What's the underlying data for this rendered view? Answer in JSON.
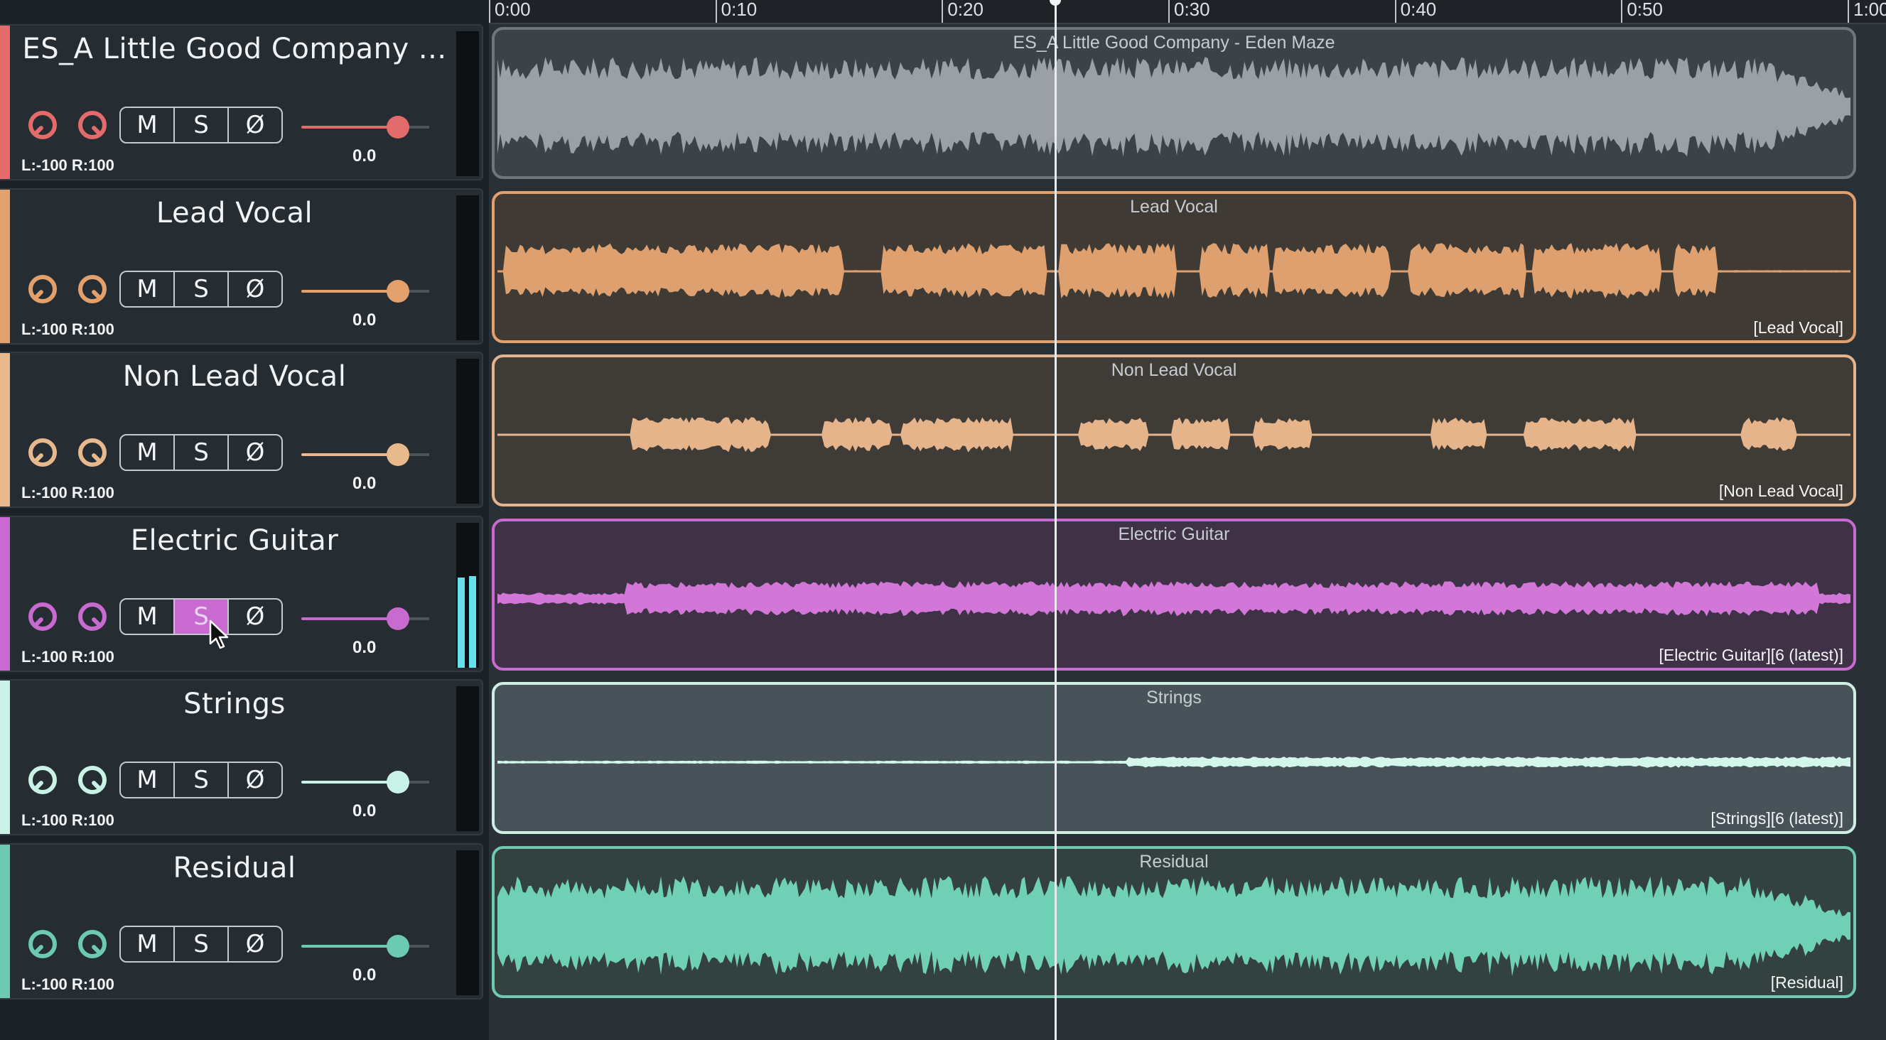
{
  "ruler": {
    "ticks": [
      {
        "label": "0:00",
        "seconds": 0
      },
      {
        "label": "0:10",
        "seconds": 10
      },
      {
        "label": "0:20",
        "seconds": 20
      },
      {
        "label": "0:30",
        "seconds": 30
      },
      {
        "label": "0:40",
        "seconds": 40
      },
      {
        "label": "0:50",
        "seconds": 50
      },
      {
        "label": "1:00",
        "seconds": 60
      }
    ],
    "playhead_seconds": 25
  },
  "tracks": [
    {
      "name": "ES_A Little Good Company ...",
      "color": "#e36b6b",
      "mute_label": "M",
      "solo_label": "S",
      "phase_label": "Ø",
      "solo_active": false,
      "pan_label": "L:-100 R:100",
      "volume": "0.0",
      "meter_level": 0,
      "clip": {
        "title": "ES_A Little Good Company - Eden Maze",
        "tag": "",
        "border": "#6e767e",
        "bg": "#3b4248",
        "wave": "#9aa0a5",
        "shape": "full"
      }
    },
    {
      "name": "Lead Vocal",
      "color": "#e4a06b",
      "mute_label": "M",
      "solo_label": "S",
      "phase_label": "Ø",
      "solo_active": false,
      "pan_label": "L:-100 R:100",
      "volume": "0.0",
      "meter_level": 0,
      "clip": {
        "title": "Lead Vocal",
        "tag": "[Lead Vocal]",
        "border": "#e4a06b",
        "bg": "#3f3a34",
        "wave": "#dea06f",
        "shape": "vocal"
      }
    },
    {
      "name": "Non Lead Vocal",
      "color": "#e9b98e",
      "mute_label": "M",
      "solo_label": "S",
      "phase_label": "Ø",
      "solo_active": false,
      "pan_label": "L:-100 R:100",
      "volume": "0.0",
      "meter_level": 0,
      "clip": {
        "title": "Non Lead Vocal",
        "tag": "[Non Lead Vocal]",
        "border": "#e3b48d",
        "bg": "#3f3b37",
        "wave": "#e6b48a",
        "shape": "sparse"
      }
    },
    {
      "name": "Electric Guitar",
      "color": "#c86ad0",
      "mute_label": "M",
      "solo_label": "S",
      "phase_label": "Ø",
      "solo_active": true,
      "pan_label": "L:-100 R:100",
      "volume": "0.0",
      "meter_level": 0.62,
      "clip": {
        "title": "Electric Guitar",
        "tag": "[Electric Guitar][6 (latest)]",
        "border": "#c86ad0",
        "bg": "#3f3146",
        "wave": "#d276d8",
        "shape": "guitar"
      }
    },
    {
      "name": "Strings",
      "color": "#c8f3e6",
      "mute_label": "M",
      "solo_label": "S",
      "phase_label": "Ø",
      "solo_active": false,
      "pan_label": "L:-100 R:100",
      "volume": "0.0",
      "meter_level": 0,
      "clip": {
        "title": "Strings",
        "tag": "[Strings][6 (latest)]",
        "border": "#cfeee4",
        "bg": "#475358",
        "wave": "#d3f7ea",
        "shape": "strings"
      }
    },
    {
      "name": "Residual",
      "color": "#6bcab0",
      "mute_label": "M",
      "solo_label": "S",
      "phase_label": "Ø",
      "solo_active": false,
      "pan_label": "L:-100 R:100",
      "volume": "0.0",
      "meter_level": 0,
      "clip": {
        "title": "Residual",
        "tag": "[Residual]",
        "border": "#6fc8b0",
        "bg": "#33413f",
        "wave": "#6fd0b6",
        "shape": "full"
      }
    }
  ]
}
